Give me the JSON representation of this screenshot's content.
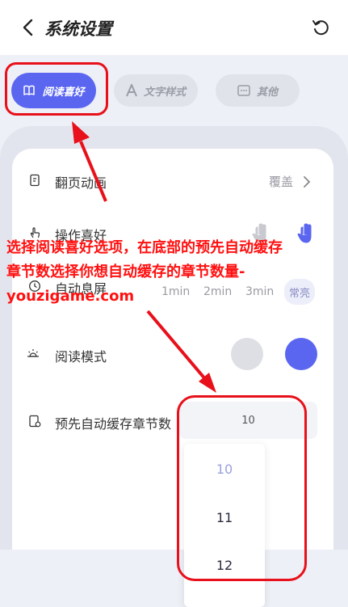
{
  "header": {
    "title": "系统设置",
    "back_icon": "chevron-left-icon",
    "reset_icon": "refresh-icon"
  },
  "tabs": [
    {
      "label": "阅读喜好",
      "icon": "book-icon",
      "active": true
    },
    {
      "label": "文字样式",
      "icon": "font-icon",
      "active": false
    },
    {
      "label": "其他",
      "icon": "more-icon",
      "active": false
    }
  ],
  "settings": {
    "page_turn": {
      "label": "翻页动画",
      "value": "覆盖"
    },
    "operation": {
      "label": "操作喜好"
    },
    "auto_lock": {
      "label": "自动息屏",
      "options": [
        "1min",
        "2min",
        "3min",
        "常亮"
      ],
      "selected": "常亮"
    },
    "reading_mode": {
      "label": "阅读模式"
    },
    "prefetch": {
      "label": "预先自动缓存章节数",
      "value": "10"
    }
  },
  "dropdown": {
    "options": [
      "10",
      "11",
      "12"
    ],
    "selected": "10"
  },
  "annotation": {
    "line1": "选择阅读喜好选项，在底部的预先自动缓存",
    "line2": "章节数选择你想自动缓存的章节数量-",
    "line3": "youzigame.com"
  },
  "colors": {
    "accent": "#5b66f0",
    "annotation": "#ff1010",
    "inactive_tab": "#e1e3ea"
  }
}
